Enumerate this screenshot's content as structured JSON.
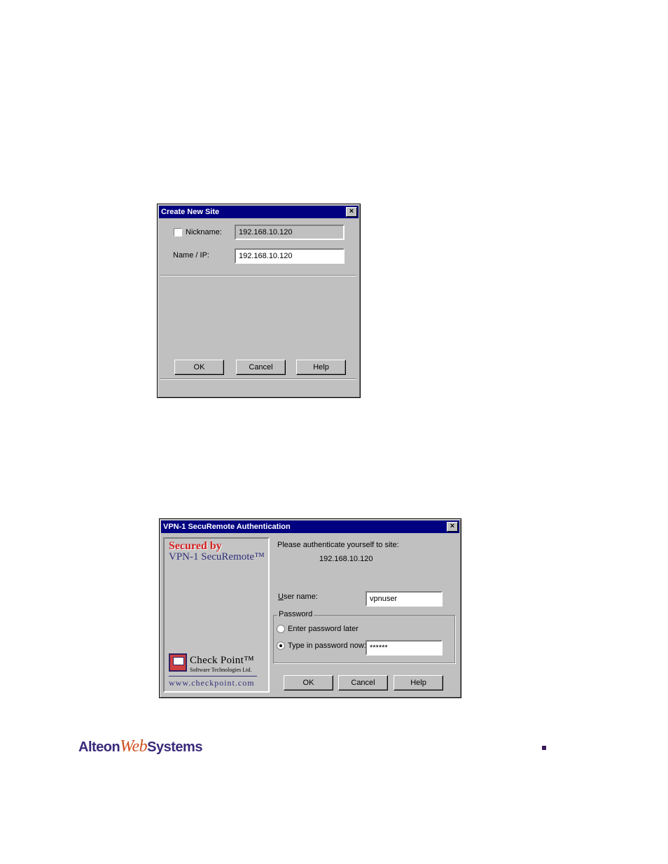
{
  "create_site": {
    "title": "Create New Site",
    "close": "×",
    "nickname_label": "Nickname:",
    "nickname_value": "192.168.10.120",
    "name_ip_label": "Name / IP:",
    "name_ip_value": "192.168.10.120",
    "ok": "OK",
    "cancel": "Cancel",
    "help": "Help"
  },
  "auth": {
    "title": "VPN-1 SecuRemote Authentication",
    "close": "×",
    "brand": {
      "secured_by": "Secured by",
      "product": "VPN-1 SecuRemote™",
      "company": "Check Point™",
      "company_sub": "Software Technologies Ltd.",
      "url": "www.checkpoint.com"
    },
    "prompt": "Please authenticate yourself to site:",
    "site": "192.168.10.120",
    "username_label": "User name:",
    "username_value": "vpnuser",
    "password_group": "Password",
    "enter_later": "Enter password later",
    "type_now": "Type in password now:",
    "password_value": "******",
    "password_mode": "type_now",
    "ok": "OK",
    "cancel": "Cancel",
    "help": "Help"
  },
  "footer": {
    "logo_alteon": "Alteon",
    "logo_web": "Web",
    "logo_systems": "Systems"
  }
}
